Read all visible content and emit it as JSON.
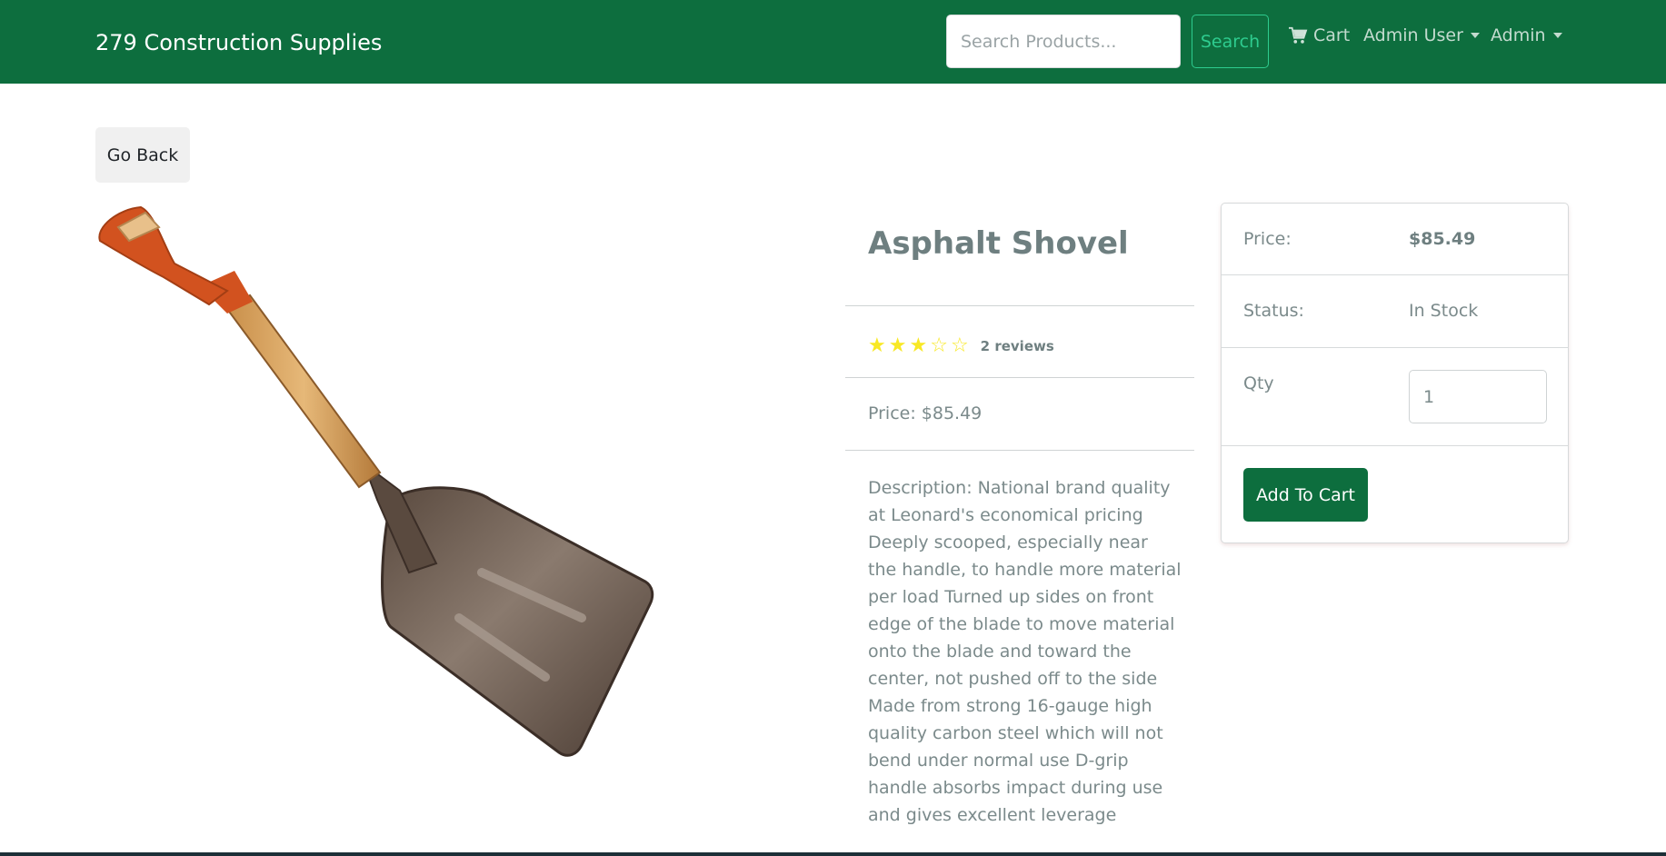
{
  "navbar": {
    "brand": "279 Construction Supplies",
    "search_placeholder": "Search Products...",
    "search_button": "Search",
    "cart_label": "Cart",
    "admin_user_label": "Admin User",
    "admin_label": "Admin",
    "background": "#0d6e3e"
  },
  "go_back_label": "Go Back",
  "product": {
    "image_alt": "asphalt-shovel-image",
    "name": "Asphalt Shovel",
    "rating": 3,
    "rating_max": 5,
    "reviews": "2 reviews",
    "price_line": "Price: $85.49",
    "description": "Description: National brand quality at Leonard's economical pricing Deeply scooped, especially near the handle, to handle more material per load Turned up sides on front edge of the blade to move material onto the blade and toward the center, not pushed off to the side Made from strong 16-gauge high quality carbon steel which will not bend under normal use D-grip handle absorbs impact during use and gives excellent leverage"
  },
  "card": {
    "price_label": "Price:",
    "price_value": "$85.49",
    "status_label": "Status:",
    "status_value": "In Stock",
    "qty_label": "Qty",
    "qty_value": "1",
    "add_button": "Add To Cart"
  },
  "colors": {
    "primary": "#0d6e3e",
    "star": "#f8e825",
    "search_outline": "#2ecc8f"
  }
}
